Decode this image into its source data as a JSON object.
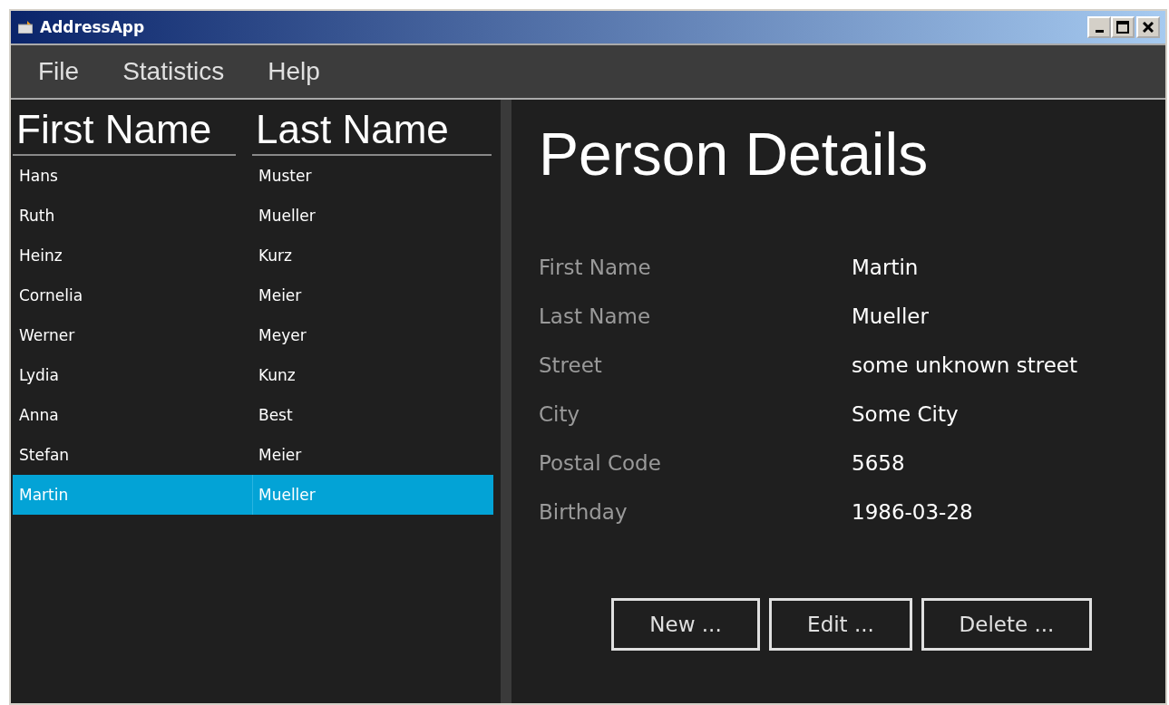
{
  "window": {
    "title": "AddressApp"
  },
  "menu": [
    "File",
    "Statistics",
    "Help"
  ],
  "table": {
    "columns": [
      "First Name",
      "Last Name"
    ],
    "rows": [
      {
        "first": "Hans",
        "last": "Muster",
        "selected": false
      },
      {
        "first": "Ruth",
        "last": "Mueller",
        "selected": false
      },
      {
        "first": "Heinz",
        "last": "Kurz",
        "selected": false
      },
      {
        "first": "Cornelia",
        "last": "Meier",
        "selected": false
      },
      {
        "first": "Werner",
        "last": "Meyer",
        "selected": false
      },
      {
        "first": "Lydia",
        "last": "Kunz",
        "selected": false
      },
      {
        "first": "Anna",
        "last": "Best",
        "selected": false
      },
      {
        "first": "Stefan",
        "last": "Meier",
        "selected": false
      },
      {
        "first": "Martin",
        "last": "Mueller",
        "selected": true
      }
    ]
  },
  "details": {
    "title": "Person Details",
    "fields": [
      {
        "label": "First Name",
        "value": "Martin"
      },
      {
        "label": "Last Name",
        "value": "Mueller"
      },
      {
        "label": "Street",
        "value": "some unknown street"
      },
      {
        "label": "City",
        "value": "Some City"
      },
      {
        "label": "Postal Code",
        "value": "5658"
      },
      {
        "label": "Birthday",
        "value": "1986-03-28"
      }
    ],
    "buttons": [
      "New ...",
      "Edit ...",
      "Delete ..."
    ]
  }
}
